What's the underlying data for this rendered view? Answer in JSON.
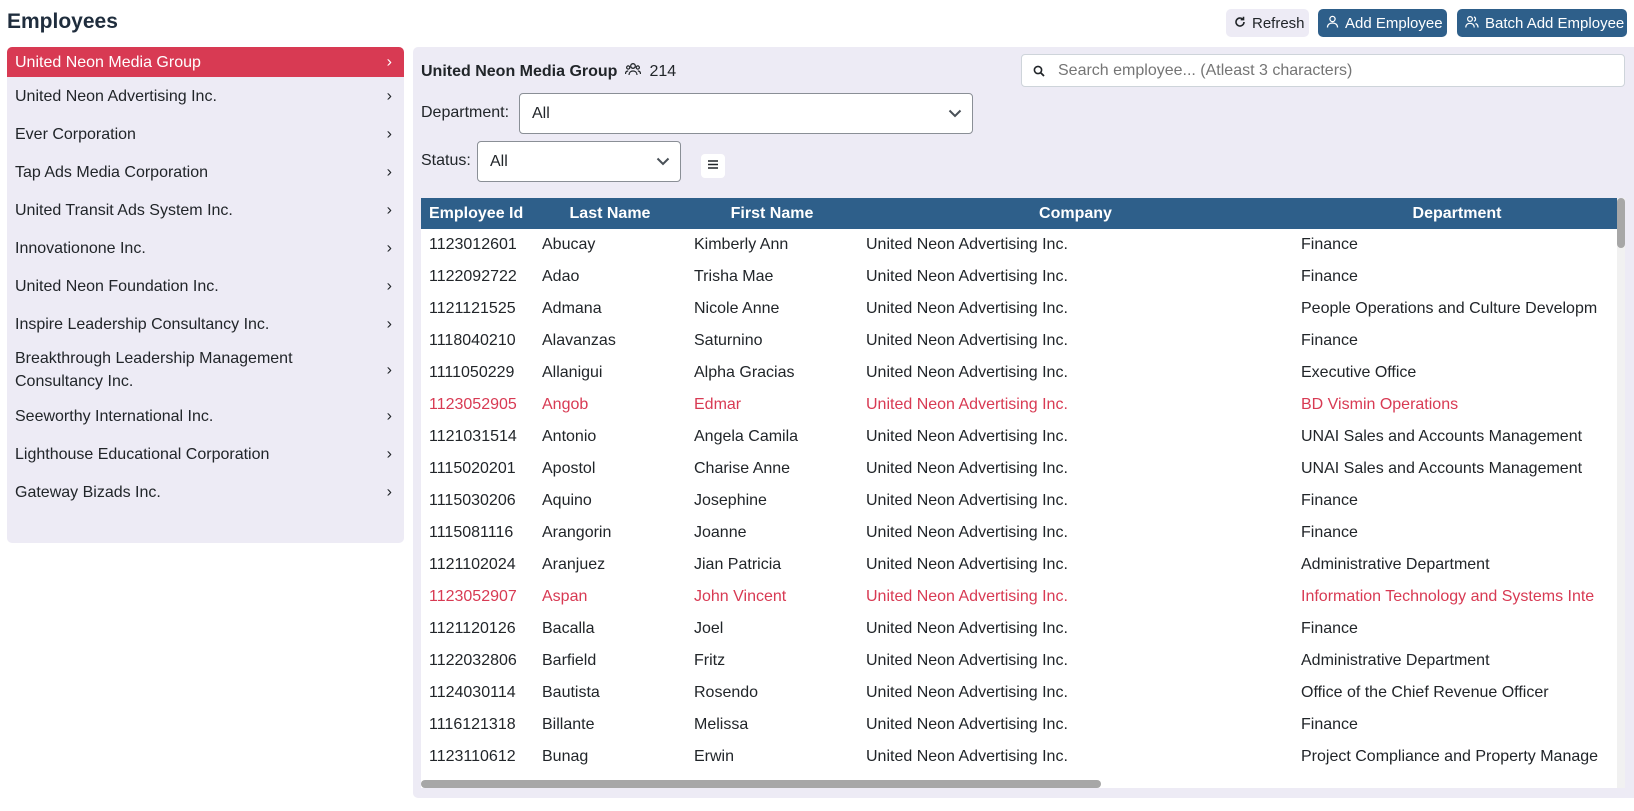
{
  "page": {
    "title": "Employees"
  },
  "toolbar": {
    "refresh": "Refresh",
    "add": "Add Employee",
    "batch": "Batch Add Employee"
  },
  "sidebar": {
    "items": [
      {
        "label": "United Neon Media Group",
        "active": true
      },
      {
        "label": "United Neon Advertising Inc."
      },
      {
        "label": "Ever Corporation"
      },
      {
        "label": "Tap Ads Media Corporation"
      },
      {
        "label": "United Transit Ads System Inc."
      },
      {
        "label": "Innovationone Inc."
      },
      {
        "label": "United Neon Foundation Inc."
      },
      {
        "label": "Inspire Leadership Consultancy Inc."
      },
      {
        "label": "Breakthrough Leadership Management Consultancy Inc."
      },
      {
        "label": "Seeworthy International Inc."
      },
      {
        "label": "Lighthouse Educational Corporation"
      },
      {
        "label": "Gateway Bizads Inc."
      }
    ]
  },
  "main": {
    "company": "United Neon Media Group",
    "count": "214",
    "search_placeholder": "Search employee... (Atleast 3 characters)",
    "department_label": "Department:",
    "department_value": "All",
    "status_label": "Status:",
    "status_value": "All"
  },
  "table": {
    "columns": [
      "Employee Id",
      "Last Name",
      "First Name",
      "Company",
      "Department"
    ],
    "rows": [
      {
        "id": "1123012601",
        "last": "Abucay",
        "first": "Kimberly Ann",
        "company": "United Neon Advertising Inc.",
        "dept": "Finance",
        "inactive": false
      },
      {
        "id": "1122092722",
        "last": "Adao",
        "first": "Trisha Mae",
        "company": "United Neon Advertising Inc.",
        "dept": "Finance",
        "inactive": false
      },
      {
        "id": "1121121525",
        "last": "Admana",
        "first": "Nicole Anne",
        "company": "United Neon Advertising Inc.",
        "dept": "People Operations and Culture Developm",
        "inactive": false
      },
      {
        "id": "1118040210",
        "last": "Alavanzas",
        "first": "Saturnino",
        "company": "United Neon Advertising Inc.",
        "dept": "Finance",
        "inactive": false
      },
      {
        "id": "1111050229",
        "last": "Allanigui",
        "first": "Alpha Gracias",
        "company": "United Neon Advertising Inc.",
        "dept": "Executive Office",
        "inactive": false
      },
      {
        "id": "1123052905",
        "last": "Angob",
        "first": "Edmar",
        "company": "United Neon Advertising Inc.",
        "dept": "BD Vismin Operations",
        "inactive": true
      },
      {
        "id": "1121031514",
        "last": "Antonio",
        "first": "Angela Camila",
        "company": "United Neon Advertising Inc.",
        "dept": "UNAI Sales and Accounts Management",
        "inactive": false
      },
      {
        "id": "1115020201",
        "last": "Apostol",
        "first": "Charise Anne",
        "company": "United Neon Advertising Inc.",
        "dept": "UNAI Sales and Accounts Management",
        "inactive": false
      },
      {
        "id": "1115030206",
        "last": "Aquino",
        "first": "Josephine",
        "company": "United Neon Advertising Inc.",
        "dept": "Finance",
        "inactive": false
      },
      {
        "id": "1115081116",
        "last": "Arangorin",
        "first": "Joanne",
        "company": "United Neon Advertising Inc.",
        "dept": "Finance",
        "inactive": false
      },
      {
        "id": "1121102024",
        "last": "Aranjuez",
        "first": "Jian Patricia",
        "company": "United Neon Advertising Inc.",
        "dept": "Administrative Department",
        "inactive": false
      },
      {
        "id": "1123052907",
        "last": "Aspan",
        "first": "John Vincent",
        "company": "United Neon Advertising Inc.",
        "dept": "Information Technology and Systems Inte",
        "inactive": true
      },
      {
        "id": "1121120126",
        "last": "Bacalla",
        "first": "Joel",
        "company": "United Neon Advertising Inc.",
        "dept": "Finance",
        "inactive": false
      },
      {
        "id": "1122032806",
        "last": "Barfield",
        "first": "Fritz",
        "company": "United Neon Advertising Inc.",
        "dept": "Administrative Department",
        "inactive": false
      },
      {
        "id": "1124030114",
        "last": "Bautista",
        "first": "Rosendo",
        "company": "United Neon Advertising Inc.",
        "dept": "Office of the Chief Revenue Officer",
        "inactive": false
      },
      {
        "id": "1116121318",
        "last": "Billante",
        "first": "Melissa",
        "company": "United Neon Advertising Inc.",
        "dept": "Finance",
        "inactive": false
      },
      {
        "id": "1123110612",
        "last": "Bunag",
        "first": "Erwin",
        "company": "United Neon Advertising Inc.",
        "dept": "Project Compliance and Property Manage",
        "inactive": false
      }
    ]
  },
  "colors": {
    "primary": "#2e5f8a",
    "accent": "#d83a53",
    "panel": "#edebf5"
  },
  "icons": {
    "refresh": "refresh-icon",
    "add": "user-icon",
    "batch": "users-icon",
    "count": "people-icon",
    "search": "search-icon",
    "caret": "chevron-down-icon",
    "columns": "menu-icon"
  }
}
